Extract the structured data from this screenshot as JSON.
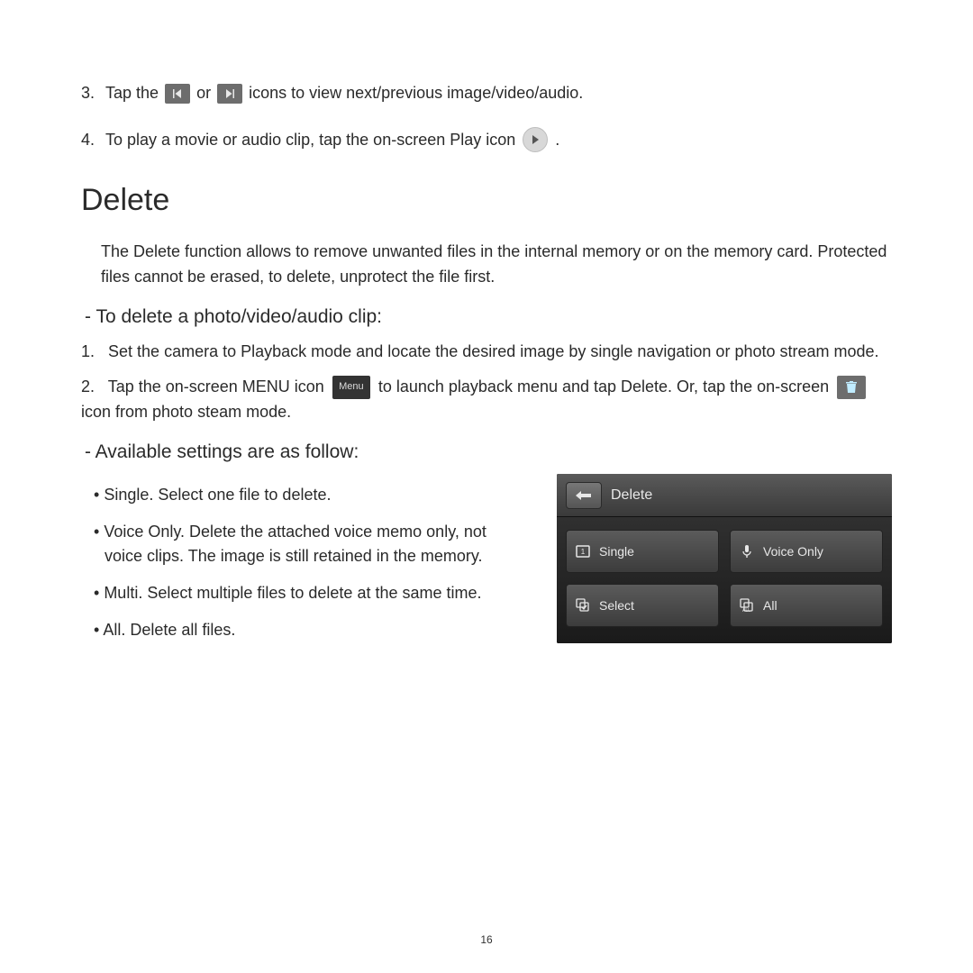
{
  "step3": {
    "num": "3.",
    "part1": "Tap the",
    "or": "or",
    "part2": "icons to view next/previous image/video/audio."
  },
  "step4": {
    "num": "4.",
    "text": "To play a movie or audio clip, tap the on-screen Play icon",
    "end": "."
  },
  "section_title": "Delete",
  "intro": "The Delete function allows to remove unwanted files in the internal memory or on the memory card. Protected files cannot be erased, to delete, unprotect the file first.",
  "subhead1": "To delete a photo/video/audio clip:",
  "del1": {
    "num": "1.",
    "text": "Set the camera to Playback mode and locate the desired image by single navigation or photo stream mode."
  },
  "del2": {
    "num": "2.",
    "p1": "Tap the on-screen MENU icon",
    "menu_label": "Menu",
    "p2": "to launch playback menu and tap Delete.  Or, tap the on-screen",
    "p3": "icon from photo steam mode."
  },
  "subhead2": "Available settings are as follow:",
  "bullets": {
    "single": "Single.  Select one file to delete.",
    "voice": "Voice Only.  Delete the attached voice memo only, not voice clips. The image is still retained in the memory.",
    "multi": "Multi.  Select multiple files to delete at the same time.",
    "all": "All.  Delete all files."
  },
  "screenshot": {
    "title": "Delete",
    "tiles": {
      "single": "Single",
      "voice": "Voice Only",
      "select": "Select",
      "all": "All"
    }
  },
  "page_num": "16"
}
